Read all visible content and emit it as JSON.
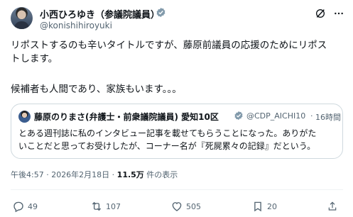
{
  "author": {
    "name": "小西ひろゆき（参議院議員）",
    "handle": "@konishihiroyuki"
  },
  "post": {
    "lines": [
      "リポストするのも辛いタイトルですが、藤原前議員の応援のためにリポス",
      "トします。",
      "候補者も人間であり、家族もいます。。。"
    ]
  },
  "quote": {
    "name": "藤原のりまさ(弁護士・前衆議院議員) 愛知10区",
    "handle": "@CDP_AICHI10",
    "separator": "·",
    "time": "16時間",
    "lines": [
      "とある週刊誌に私のインタビュー記事を載せてもらうことになった。ありがた",
      "いことだと思ってお受けしたが、コーナー名が『死屍累々の記録』だという。"
    ]
  },
  "meta": {
    "timestamp": "午後4:57 · 2026年2月18日 · ",
    "views_count": "11.5万",
    "views_label": " 件の表示"
  },
  "actions": {
    "replies": "49",
    "reposts": "107",
    "likes": "505",
    "bookmarks_count": "20"
  },
  "colors": {
    "verified": "#829aab",
    "secondary_text": "#536471",
    "border": "#cfd9de"
  }
}
